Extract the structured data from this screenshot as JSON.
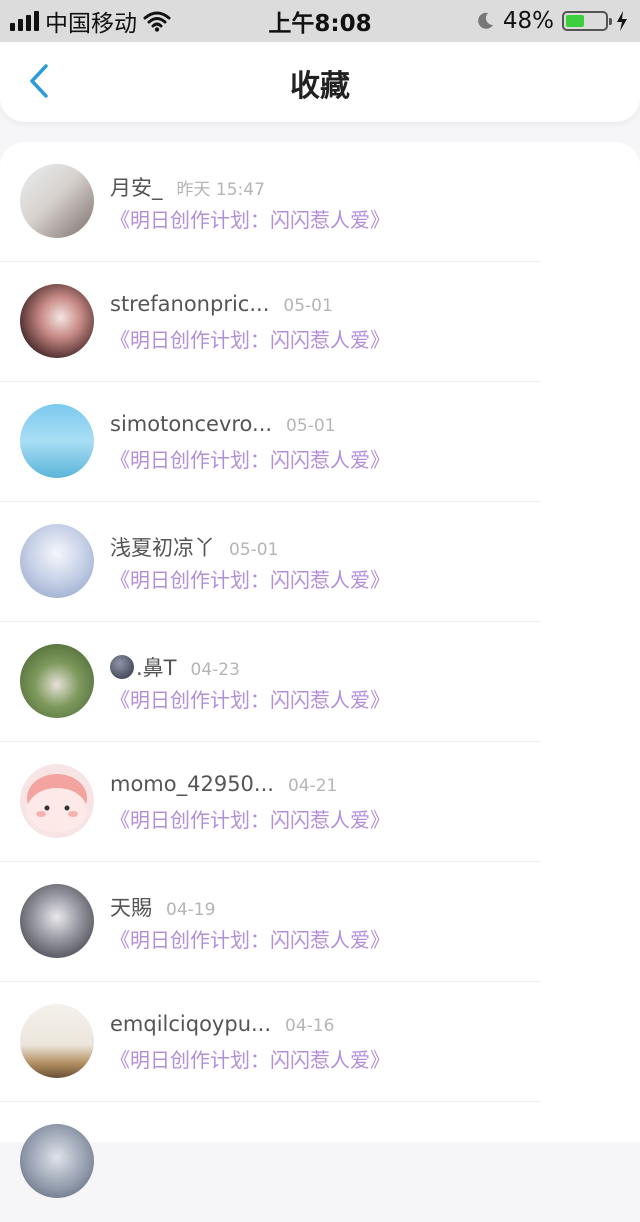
{
  "status_bar": {
    "carrier": "中国移动",
    "time": "上午8:08",
    "battery_percent": "48%",
    "battery_level": 0.48
  },
  "header": {
    "title": "收藏",
    "back_icon": "chevron-left-icon"
  },
  "colors": {
    "accent": "#2d9cdb",
    "link": "#b48fd8",
    "battery": "#3ecf3e"
  },
  "favorites": [
    {
      "name": "月安_",
      "date": "昨天 15:47",
      "title": "《明日创作计划：闪闪惹人爱》"
    },
    {
      "name": "strefanonpric...",
      "date": "05-01",
      "title": "《明日创作计划：闪闪惹人爱》"
    },
    {
      "name": "simotoncevro...",
      "date": "05-01",
      "title": "《明日创作计划：闪闪惹人爱》"
    },
    {
      "name": "浅夏初凉丫",
      "date": "05-01",
      "title": "《明日创作计划：闪闪惹人爱》"
    },
    {
      "name": ".鼻T",
      "date": "04-23",
      "title": "《明日创作计划：闪闪惹人爱》"
    },
    {
      "name": "momo_42950...",
      "date": "04-21",
      "title": "《明日创作计划：闪闪惹人爱》"
    },
    {
      "name": "天賜",
      "date": "04-19",
      "title": "《明日创作计划：闪闪惹人爱》"
    },
    {
      "name": "emqilciqoypu...",
      "date": "04-16",
      "title": "《明日创作计划：闪闪惹人爱》"
    }
  ]
}
